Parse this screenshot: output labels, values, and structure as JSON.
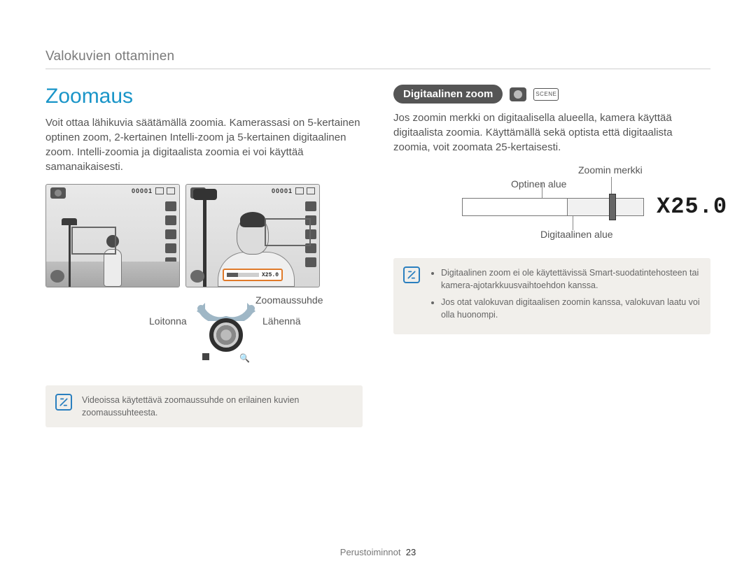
{
  "breadcrumb": "Valokuvien ottaminen",
  "left": {
    "heading": "Zoomaus",
    "intro": "Voit ottaa lähikuvia säätämällä zoomia. Kamerassasi on 5-kertainen optinen zoom, 2-kertainen Intelli-zoom ja 5-kertainen digitaalinen zoom. Intelli-zoomia ja digitaalista zoomia ei voi käyttää samanaikaisesti.",
    "shot_counter": "00001",
    "zoom_bar_value": "X25.0",
    "zoom_ratio_label": "Zoomaussuhde",
    "dial_out": "Loitonna",
    "dial_in": "Lähennä",
    "note": "Videoissa käytettävä zoomaussuhde on erilainen kuvien zoomaussuhteesta."
  },
  "right": {
    "pill": "Digitaalinen zoom",
    "mode_chip": "SCENE",
    "intro": "Jos zoomin merkki on digitaalisella alueella, kamera käyttää digitaalista zoomia. Käyttämällä sekä optista että digitaalista zoomia, voit zoomata 25-kertaisesti.",
    "label_indicator": "Zoomin merkki",
    "label_optical": "Optinen alue",
    "label_digital": "Digitaalinen alue",
    "zoom_value": "X25.0",
    "notes": [
      "Digitaalinen zoom ei ole käytettävissä Smart-suodatintehosteen tai kamera-ajotarkkuusvaihtoehdon kanssa.",
      "Jos otat valokuvan digitaalisen zoomin kanssa, valokuvan laatu voi olla huonompi."
    ]
  },
  "footer": {
    "section": "Perustoiminnot",
    "page": "23"
  }
}
